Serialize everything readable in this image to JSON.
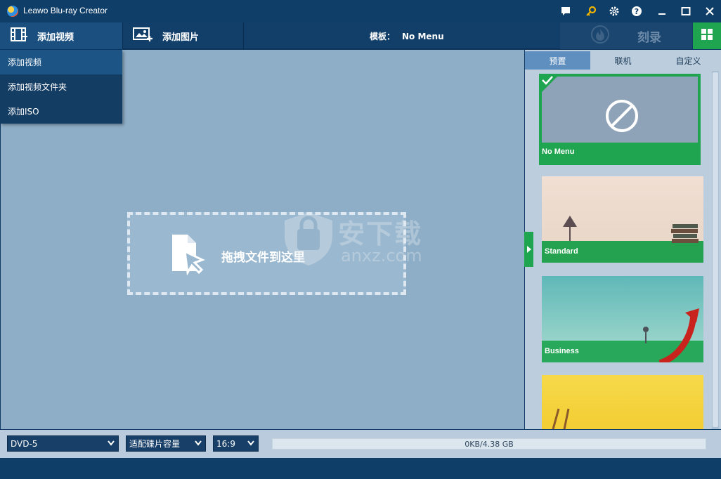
{
  "app": {
    "title": "Leawo Blu-ray Creator"
  },
  "titlebar_icons": [
    "message-icon",
    "key-icon",
    "gear-icon",
    "help-icon",
    "minimize-icon",
    "maximize-icon",
    "close-icon"
  ],
  "toolbar": {
    "add_video_label": "添加视频",
    "add_photo_label": "添加图片",
    "template_label": "模板：",
    "template_value": "No Menu",
    "burn_label": "刻录"
  },
  "dropdown": {
    "items": [
      {
        "label": "添加视频"
      },
      {
        "label": "添加视频文件夹"
      },
      {
        "label": "添加ISO"
      }
    ]
  },
  "dropzone": {
    "text": "拖拽文件到这里"
  },
  "watermark": {
    "text": "安下载",
    "sub": "anxz.com"
  },
  "right_panel": {
    "tabs": [
      {
        "label": "预置"
      },
      {
        "label": "联机"
      },
      {
        "label": "自定义"
      }
    ],
    "templates": [
      {
        "name": "No Menu",
        "selected": true
      },
      {
        "name": "Standard",
        "selected": false
      },
      {
        "name": "Business",
        "selected": false
      },
      {
        "name": "",
        "selected": false
      }
    ]
  },
  "bottom": {
    "disc_type": "DVD-5",
    "quality": "适配碟片容量",
    "aspect": "16:9",
    "capacity_text": "0KB/4.38 GB",
    "capacity_used_fraction": 0.0
  },
  "colors": {
    "accent_green": "#1fa44f",
    "dark_blue": "#0f3e68",
    "main_bg": "#8eaec7"
  }
}
